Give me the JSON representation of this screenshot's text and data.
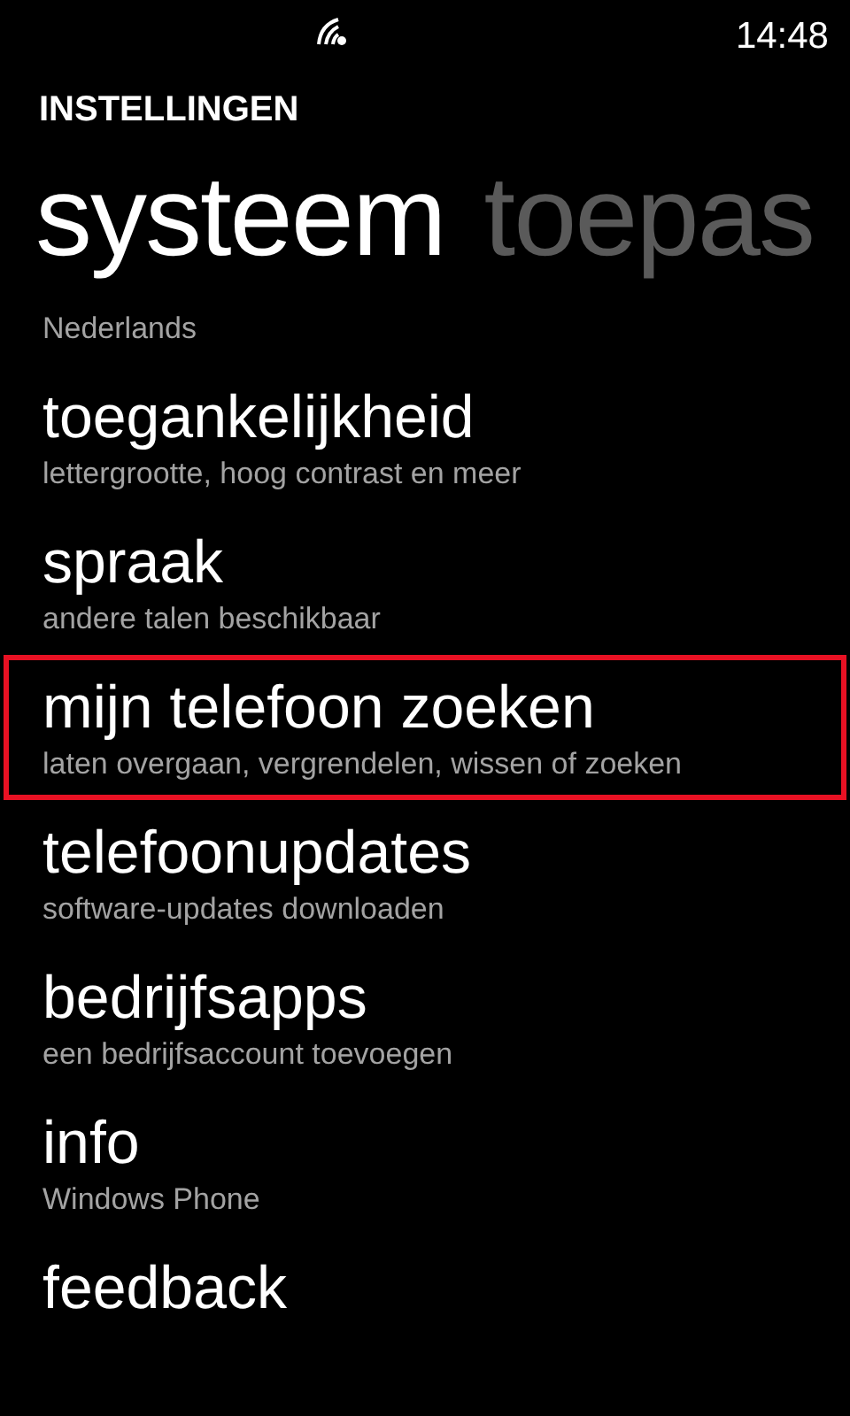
{
  "status_bar": {
    "time": "14:48"
  },
  "app_title": "INSTELLINGEN",
  "pivots": [
    {
      "label": "systeem",
      "selected": true
    },
    {
      "label": "toepas",
      "selected": false
    }
  ],
  "items": [
    {
      "subtitle": "Nederlands",
      "highlighted": false
    },
    {
      "title": "toegankelijkheid",
      "subtitle": "lettergrootte, hoog contrast en meer",
      "highlighted": false
    },
    {
      "title": "spraak",
      "subtitle": "andere talen beschikbaar",
      "highlighted": false
    },
    {
      "title": "mijn telefoon zoeken",
      "subtitle": "laten overgaan, vergrendelen, wissen of zoeken",
      "highlighted": true
    },
    {
      "title": "telefoonupdates",
      "subtitle": "software-updates downloaden",
      "highlighted": false
    },
    {
      "title": "bedrijfsapps",
      "subtitle": "een bedrijfsaccount toevoegen",
      "highlighted": false
    },
    {
      "title": "info",
      "subtitle": "Windows Phone",
      "highlighted": false
    },
    {
      "title": "feedback",
      "highlighted": false
    }
  ]
}
